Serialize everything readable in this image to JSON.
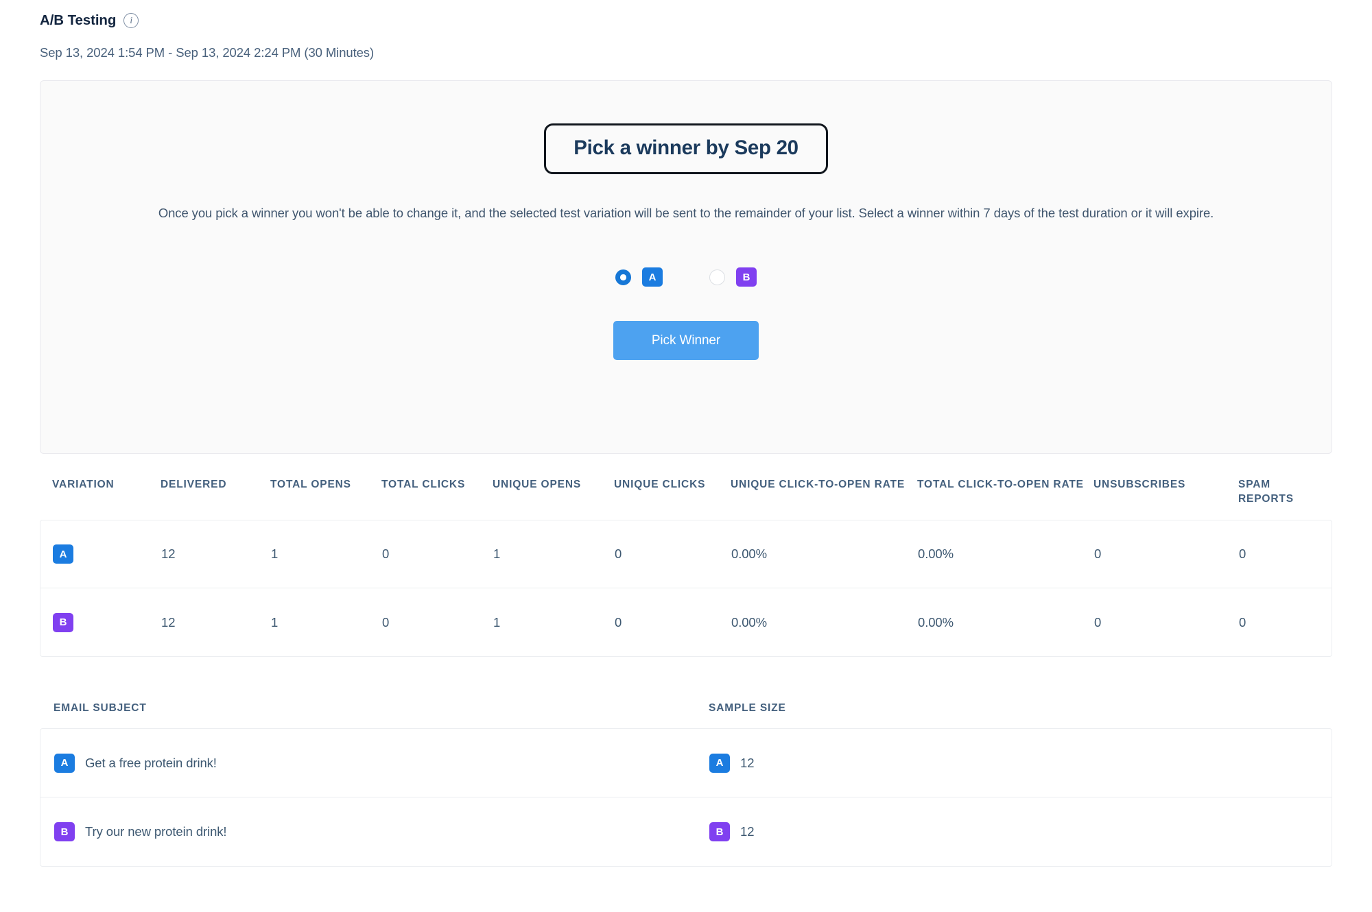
{
  "header": {
    "title": "A/B Testing",
    "info_icon": "info-icon",
    "date_range": "Sep 13, 2024 1:54 PM - Sep 13, 2024 2:24 PM (30 Minutes)"
  },
  "winner_panel": {
    "pill_label": "Pick a winner by Sep 20",
    "description": "Once you pick a winner you won't be able to change it, and the selected test variation will be sent to the remainder of your list. Select a winner within 7 days of the test duration or it will expire.",
    "choices": [
      {
        "label": "A",
        "selected": true,
        "color": "#1b7ce0"
      },
      {
        "label": "B",
        "selected": false,
        "color": "#8040f0"
      }
    ],
    "pick_winner_button": "Pick Winner",
    "button_color": "#4da2f0"
  },
  "metrics_table": {
    "columns": [
      "VARIATION",
      "DELIVERED",
      "TOTAL OPENS",
      "TOTAL CLICKS",
      "UNIQUE OPENS",
      "UNIQUE CLICKS",
      "UNIQUE CLICK-TO-OPEN RATE",
      "TOTAL CLICK-TO-OPEN RATE",
      "UNSUBSCRIBES",
      "SPAM REPORTS"
    ],
    "rows": [
      {
        "variation": "A",
        "delivered": "12",
        "total_opens": "1",
        "total_clicks": "0",
        "unique_opens": "1",
        "unique_clicks": "0",
        "unique_click_to_open_rate": "0.00%",
        "total_click_to_open_rate": "0.00%",
        "unsubscribes": "0",
        "spam_reports": "0"
      },
      {
        "variation": "B",
        "delivered": "12",
        "total_opens": "1",
        "total_clicks": "0",
        "unique_opens": "1",
        "unique_clicks": "0",
        "unique_click_to_open_rate": "0.00%",
        "total_click_to_open_rate": "0.00%",
        "unsubscribes": "0",
        "spam_reports": "0"
      }
    ]
  },
  "subject_table": {
    "columns": [
      "EMAIL SUBJECT",
      "SAMPLE SIZE"
    ],
    "rows": [
      {
        "variation": "A",
        "subject": "Get a free protein drink!",
        "sample_size": "12"
      },
      {
        "variation": "B",
        "subject": "Try our new protein drink!",
        "sample_size": "12"
      }
    ]
  }
}
